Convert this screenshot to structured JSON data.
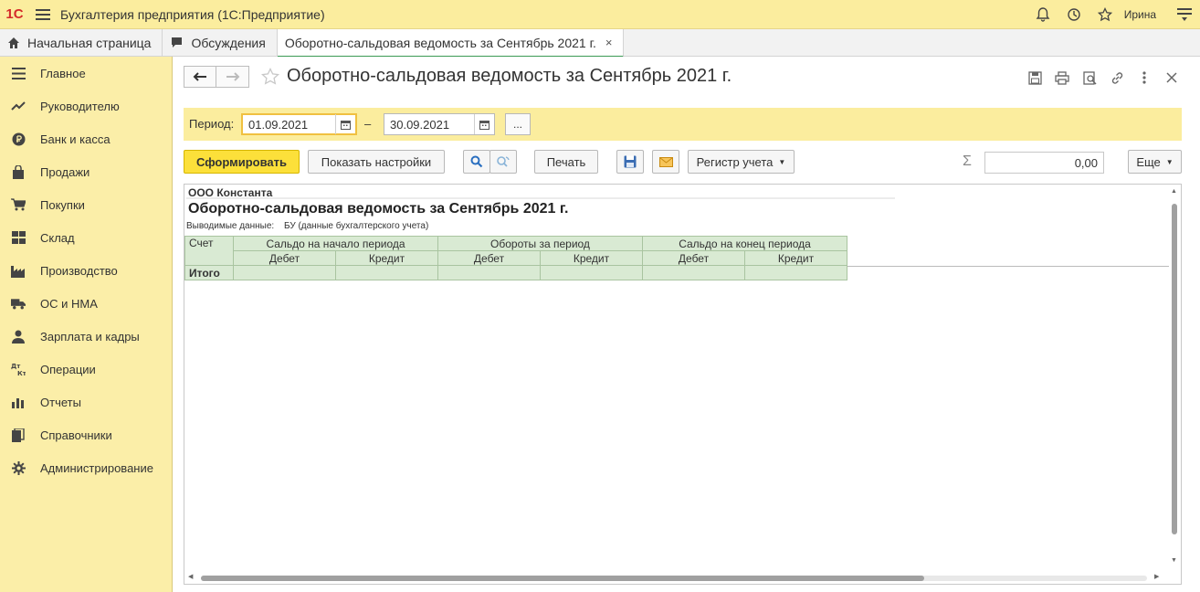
{
  "app": {
    "logo": "1С",
    "title": "Бухгалтерия предприятия  (1С:Предприятие)",
    "user": "Ирина"
  },
  "tabs": [
    {
      "label": "Начальная страница",
      "icon": "home-icon"
    },
    {
      "label": "Обсуждения",
      "icon": "chat-icon"
    },
    {
      "label": "Оборотно-сальдовая ведомость за Сентябрь 2021 г.",
      "active": true,
      "close": "×"
    }
  ],
  "sidebar": {
    "items": [
      {
        "label": "Главное",
        "icon": "list-icon"
      },
      {
        "label": "Руководителю",
        "icon": "trend-icon"
      },
      {
        "label": "Банк и касса",
        "icon": "ruble-icon"
      },
      {
        "label": "Продажи",
        "icon": "bag-icon"
      },
      {
        "label": "Покупки",
        "icon": "cart-icon"
      },
      {
        "label": "Склад",
        "icon": "grid-icon"
      },
      {
        "label": "Производство",
        "icon": "factory-icon"
      },
      {
        "label": "ОС и НМА",
        "icon": "truck-icon"
      },
      {
        "label": "Зарплата и кадры",
        "icon": "person-icon"
      },
      {
        "label": "Операции",
        "icon": "dt-kt-icon"
      },
      {
        "label": "Отчеты",
        "icon": "bar-chart-icon"
      },
      {
        "label": "Справочники",
        "icon": "books-icon"
      },
      {
        "label": "Администрирование",
        "icon": "gear-icon"
      }
    ]
  },
  "document": {
    "title": "Оборотно-сальдовая ведомость за Сентябрь 2021 г."
  },
  "period": {
    "label": "Период:",
    "from": "01.09.2021",
    "dash": "–",
    "to": "30.09.2021",
    "more": "..."
  },
  "toolbar": {
    "generate": "Сформировать",
    "show_settings": "Показать настройки",
    "print": "Печать",
    "register": "Регистр учета",
    "sum_value": "0,00",
    "more": "Еще",
    "sigma": "Σ"
  },
  "report": {
    "org": "ООО Константа",
    "title": "Оборотно-сальдовая ведомость за Сентябрь 2021 г.",
    "output_label": "Выводимые данные:",
    "output_value": "БУ (данные бухгалтерского учета)",
    "headers": {
      "account": "Счет",
      "opening": "Сальдо на начало периода",
      "turnover": "Обороты за период",
      "closing": "Сальдо на конец периода",
      "debit": "Дебет",
      "credit": "Кредит"
    },
    "total_label": "Итого"
  }
}
